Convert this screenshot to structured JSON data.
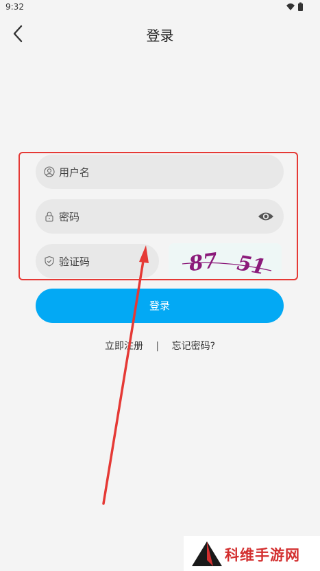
{
  "status_bar": {
    "time": "9:32"
  },
  "header": {
    "title": "登录"
  },
  "form": {
    "username_placeholder": "用户名",
    "password_placeholder": "密码",
    "captcha_placeholder": "验证码",
    "captcha_left": "87",
    "captcha_right": "51"
  },
  "login_button": "登录",
  "links": {
    "register": "立即注册",
    "separator": "|",
    "forgot": "忘记密码?"
  },
  "watermark": "科维手游网",
  "colors": {
    "primary": "#03a9f4",
    "annotation": "#e53935",
    "captcha_text": "#8b1a7a"
  }
}
